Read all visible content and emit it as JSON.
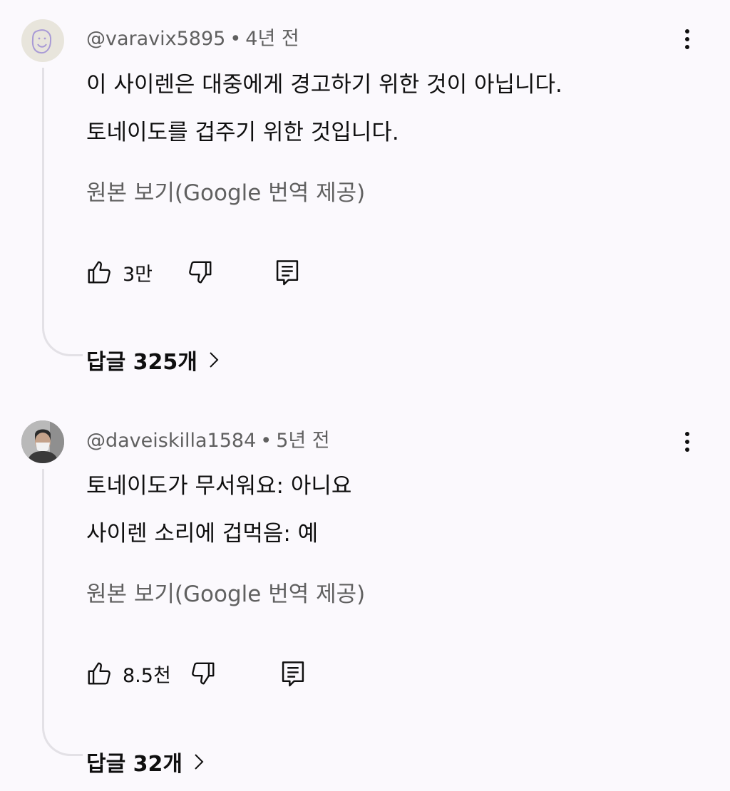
{
  "comments": [
    {
      "handle": "@varavix5895",
      "separator": "•",
      "time": "4년 전",
      "lines": [
        "이 사이렌은 대중에게 경고하기 위한 것이 아닙니다.",
        "토네이도를 겁주기 위한 것입니다."
      ],
      "translate_link": "원본 보기(Google 번역 제공)",
      "likes": "3만",
      "replies": "답글 325개",
      "avatar_icon": "smiley-doodle-avatar"
    },
    {
      "handle": "@daveiskilla1584",
      "separator": "•",
      "time": "5년 전",
      "lines": [
        "토네이도가 무서워요: 아니요",
        "사이렌 소리에 겁먹음: 예"
      ],
      "translate_link": "원본 보기(Google 번역 제공)",
      "likes": "8.5천",
      "replies": "답글 32개",
      "avatar_icon": "person-photo-avatar"
    }
  ],
  "icons": {
    "like": "thumbs-up-icon",
    "dislike": "thumbs-down-icon",
    "reply": "reply-comment-icon",
    "more": "more-vertical-icon",
    "chevron": "chevron-right-icon"
  },
  "colors": {
    "background": "#fbf9fd",
    "text": "#0f0f0f",
    "secondary_text": "#606060",
    "thread_line": "#e3e1e6"
  }
}
